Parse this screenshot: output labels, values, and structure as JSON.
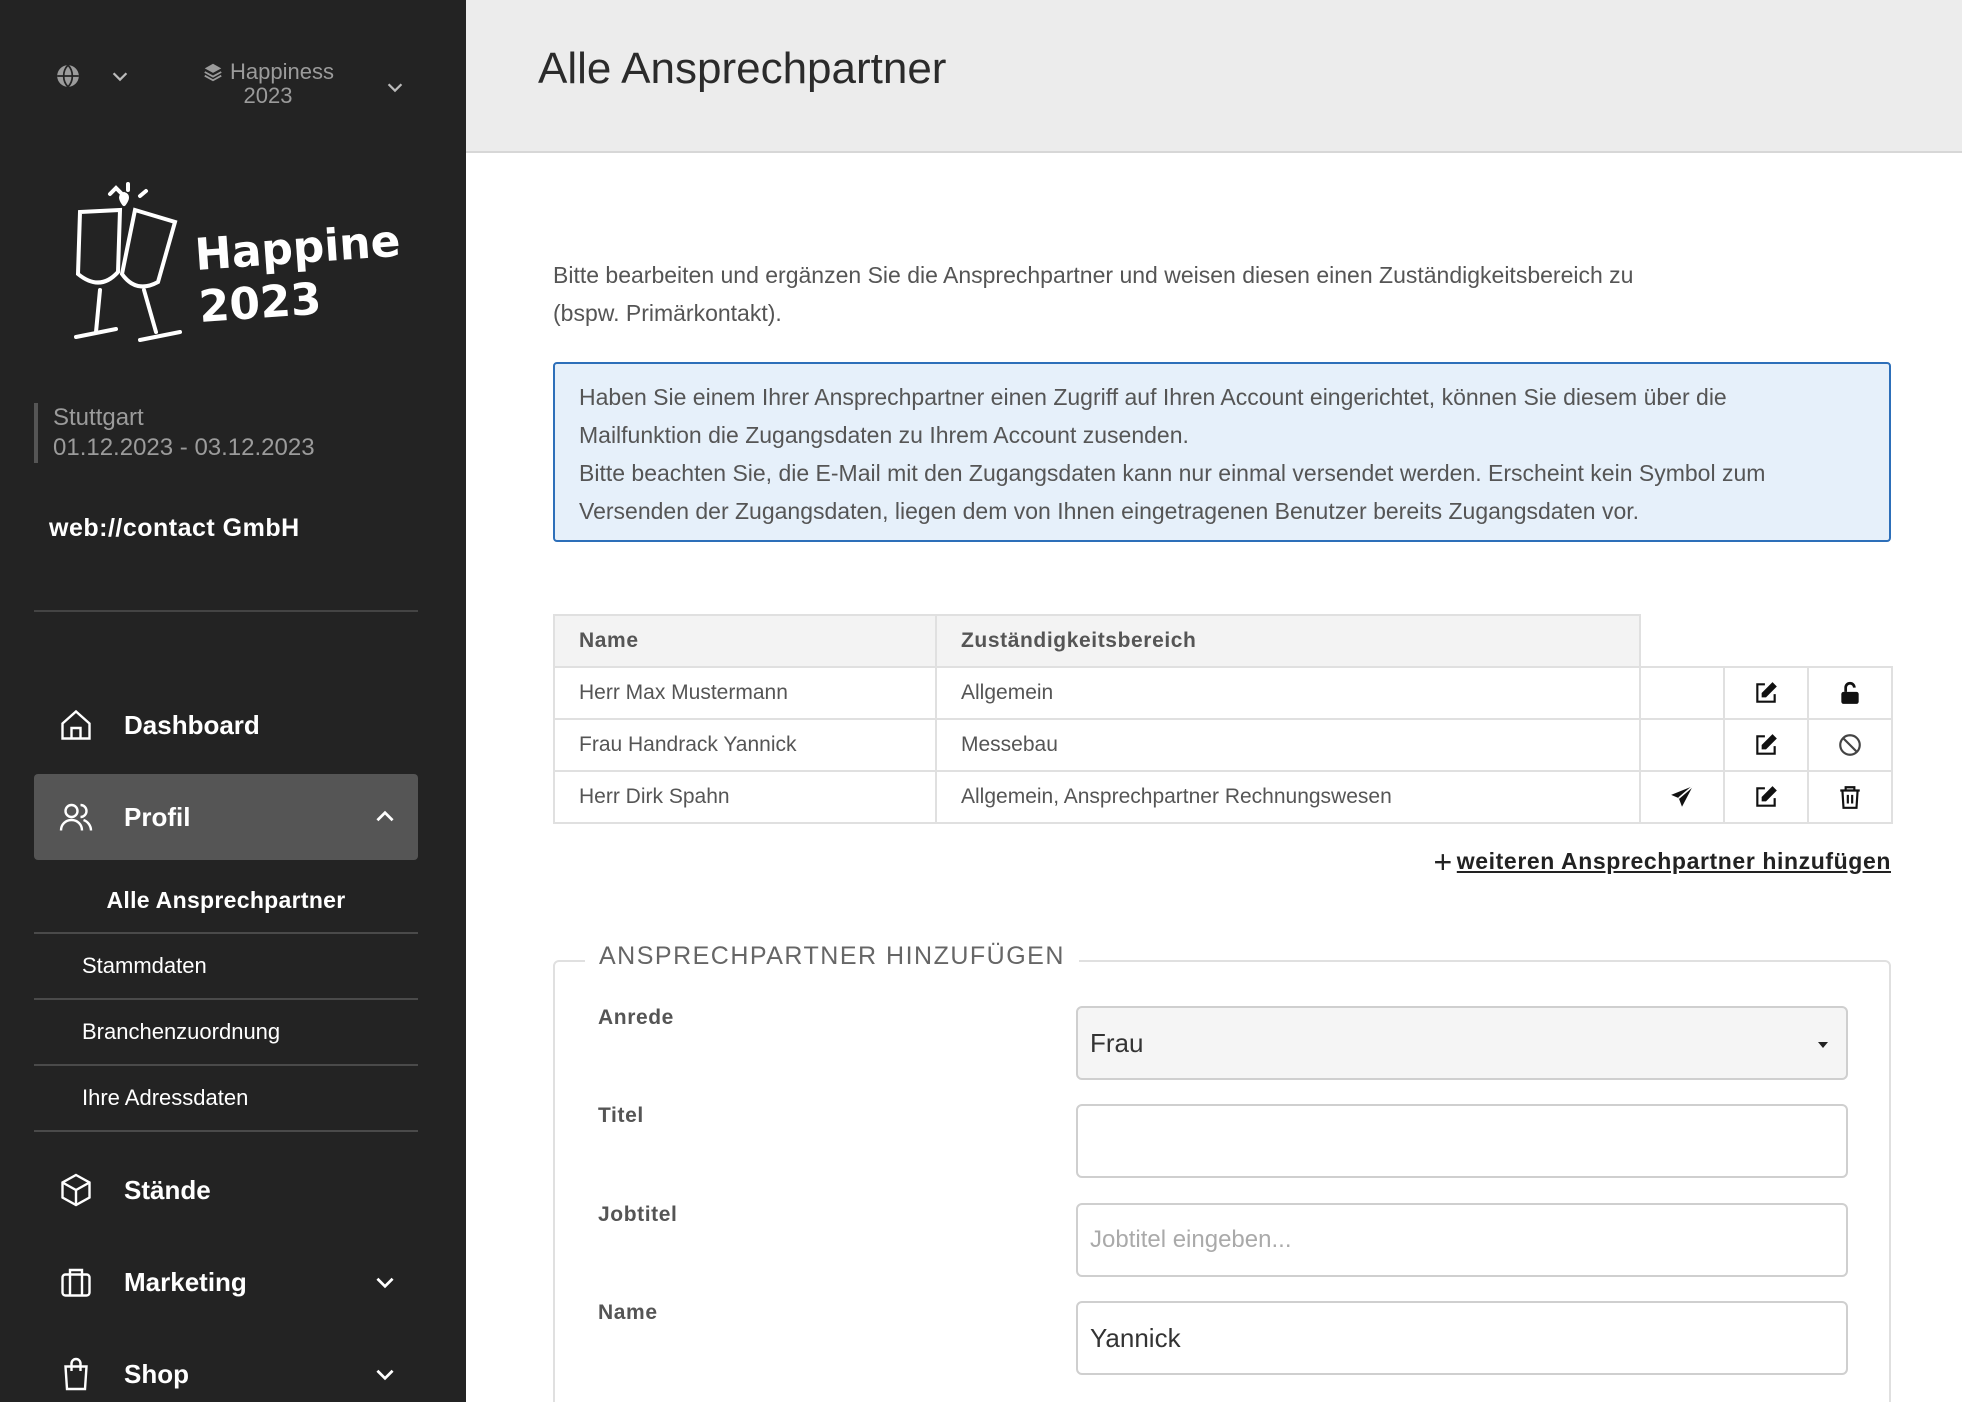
{
  "sidebar": {
    "event_selector": {
      "name_line1": "Happiness",
      "name_line2": "2023"
    },
    "logo_text": {
      "line1": "Happiness",
      "line2": "2023"
    },
    "location": "Stuttgart",
    "dates": "01.12.2023 - 03.12.2023",
    "company": "web://contact GmbH",
    "nav": {
      "dashboard": "Dashboard",
      "profil": "Profil",
      "staende": "Stände",
      "marketing": "Marketing",
      "shop": "Shop"
    },
    "profil_sub": {
      "alle": "Alle Ansprechpartner",
      "stammdaten": "Stammdaten",
      "branchen": "Branchenzuordnung",
      "adressdaten": "Ihre Adressdaten"
    }
  },
  "header": {
    "title": "Alle Ansprechpartner"
  },
  "intro": {
    "line1": "Bitte bearbeiten und ergänzen Sie die Ansprechpartner und weisen diesen einen Zuständigkeitsbereich zu",
    "line2": "(bspw. Primärkontakt)."
  },
  "info_box": {
    "line1": "Haben Sie einem Ihrer Ansprechpartner einen Zugriff auf Ihren Account eingerichtet, können Sie diesem über die",
    "line2": "Mailfunktion die Zugangsdaten zu Ihrem Account zusenden.",
    "line3": "Bitte beachten Sie, die E-Mail mit den Zugangsdaten kann nur einmal versendet werden. Erscheint kein Symbol zum",
    "line4": "Versenden der Zugangsdaten, liegen dem von Ihnen eingetragenen Benutzer bereits Zugangsdaten vor."
  },
  "table": {
    "headers": {
      "name": "Name",
      "area": "Zuständigkeitsbereich"
    },
    "rows": [
      {
        "name": "Herr Max Mustermann",
        "area": "Allgemein",
        "actions": [
          "edit-icon",
          "unlock-icon"
        ]
      },
      {
        "name": "Frau Handrack Yannick",
        "area": "Messebau",
        "actions": [
          "edit-icon",
          "ban-icon"
        ]
      },
      {
        "name": "Herr Dirk Spahn",
        "area": "Allgemein, Ansprechpartner Rechnungswesen",
        "actions": [
          "send-icon",
          "edit-icon",
          "trash-icon"
        ]
      }
    ]
  },
  "add_link": "weiteren Ansprechpartner hinzufügen",
  "form": {
    "legend": "ANSPRECHPARTNER HINZUFÜGEN",
    "anrede": {
      "label": "Anrede",
      "value": "Frau"
    },
    "titel": {
      "label": "Titel",
      "value": ""
    },
    "jobtitel": {
      "label": "Jobtitel",
      "placeholder": "Jobtitel eingeben..."
    },
    "name": {
      "label": "Name",
      "value": "Yannick"
    }
  },
  "colors": {
    "sidebar_bg": "#232323",
    "header_bg": "#ececec",
    "info_border": "#2d6fb9",
    "info_bg": "#e6f0fa",
    "active_nav": "#555555"
  }
}
